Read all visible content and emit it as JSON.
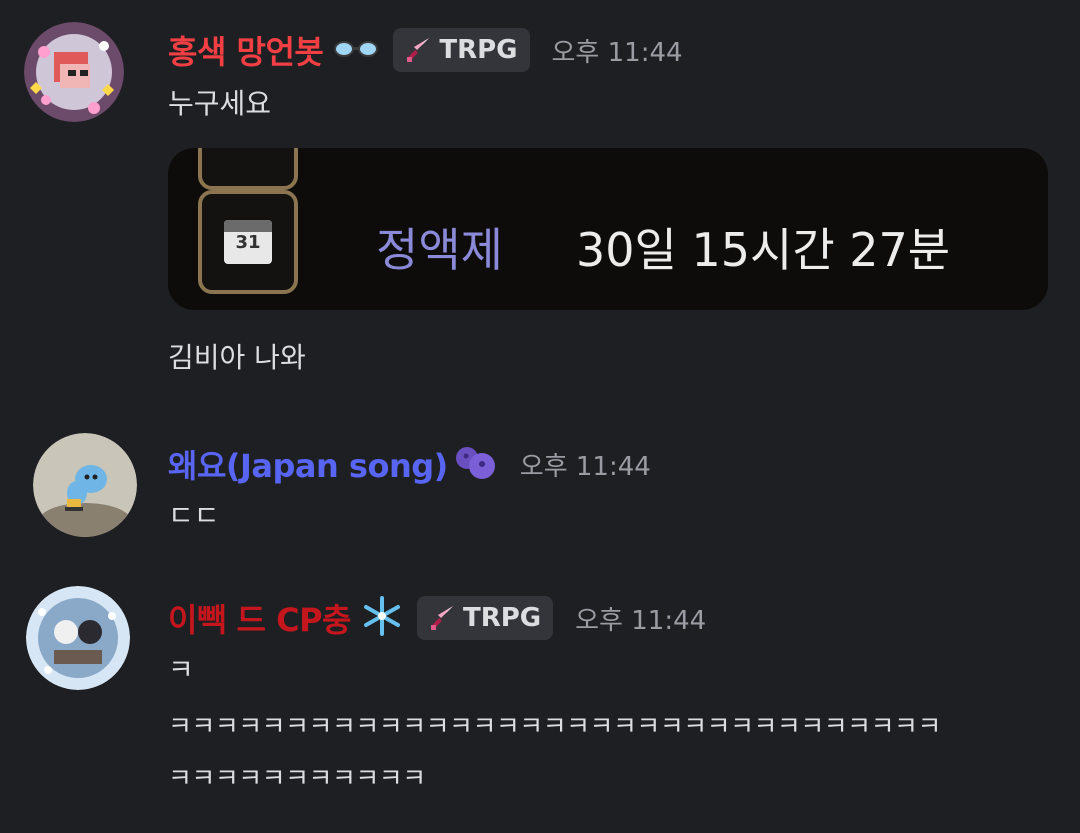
{
  "messages": [
    {
      "username": "홍색 망언봇",
      "username_color": "#f23f43",
      "badge": "TRPG",
      "timestamp": "오후 11:44",
      "lines": [
        "누구세요"
      ],
      "after_embed": "김비아 나와",
      "embed": {
        "event_name": "정액제",
        "event_time": "30일 15시간 27분",
        "calendar_day": "31"
      }
    },
    {
      "username": "왜요(Japan song)",
      "username_color": "#5865f2",
      "timestamp": "오후 11:44",
      "lines": [
        "ㄷㄷ"
      ]
    },
    {
      "username": "이빽 드 CP충",
      "username_color": "#c4161c",
      "badge": "TRPG",
      "timestamp": "오후 11:44",
      "lines": [
        "ㅋ",
        "ㅋㅋㅋㅋㅋㅋㅋㅋㅋㅋㅋㅋㅋㅋㅋㅋㅋㅋㅋㅋㅋㅋㅋㅋㅋㅋㅋㅋㅋㅋㅋㅋㅋ",
        "ㅋㅋㅋㅋㅋㅋㅋㅋㅋㅋㅋ"
      ]
    }
  ],
  "icons": {
    "glasses": "glasses-emoji-icon",
    "sword": "sword-icon",
    "blueberries": "blueberries-emoji-icon",
    "snowflake": "snowflake-emoji-icon"
  }
}
